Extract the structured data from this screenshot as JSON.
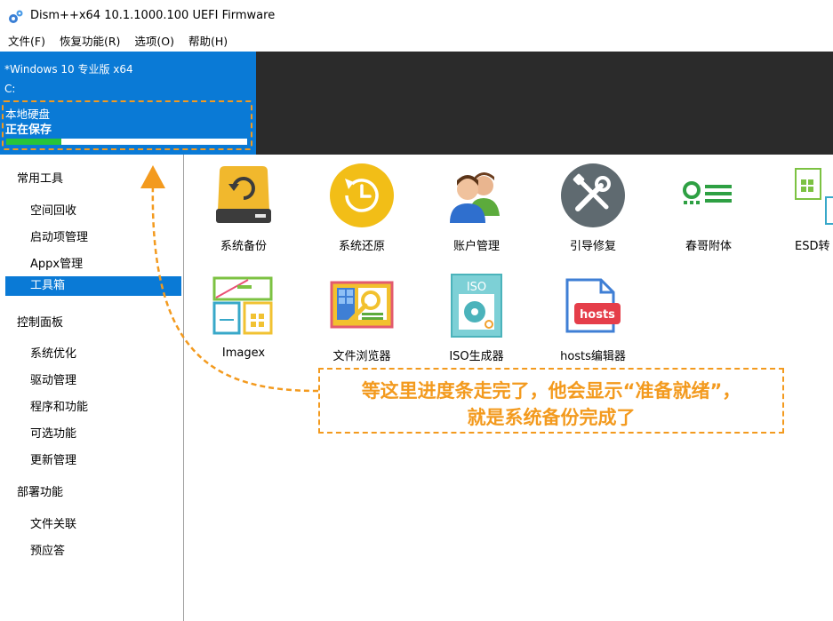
{
  "window": {
    "title": "Dism++x64 10.1.1000.100 UEFI Firmware"
  },
  "menu": [
    "文件(F)",
    "恢复功能(R)",
    "选项(O)",
    "帮助(H)"
  ],
  "session": {
    "os": "*Windows 10 专业版 x64",
    "drive": "C:",
    "disk": "本地硬盘",
    "status": "正在保存",
    "progress_percent": 23
  },
  "sidebar": {
    "sections": [
      {
        "title": "常用工具",
        "items": [
          "空间回收",
          "启动项管理",
          "Appx管理",
          "工具箱"
        ]
      },
      {
        "title": "控制面板",
        "items": [
          "系统优化",
          "驱动管理",
          "程序和功能",
          "可选功能",
          "更新管理"
        ]
      },
      {
        "title": "部署功能",
        "items": [
          "文件关联",
          "预应答"
        ]
      }
    ],
    "selected": "工具箱"
  },
  "tools": [
    {
      "label": "系统备份",
      "icon": "backup-drive-icon"
    },
    {
      "label": "系统还原",
      "icon": "restore-clock-icon"
    },
    {
      "label": "账户管理",
      "icon": "users-icon"
    },
    {
      "label": "引导修复",
      "icon": "wrench-screwdriver-icon"
    },
    {
      "label": "春哥附体",
      "icon": "toggle-list-icon"
    },
    {
      "label": "ESD转",
      "icon": "esd-convert-icon"
    },
    {
      "label": "Imagex",
      "icon": "imagex-icon"
    },
    {
      "label": "文件浏览器",
      "icon": "file-browser-icon"
    },
    {
      "label": "ISO生成器",
      "icon": "iso-disc-icon"
    },
    {
      "label": "hosts编辑器",
      "icon": "hosts-file-icon"
    }
  ],
  "annotation": {
    "line1": "等这里进度条走完了，他会显示“准备就绪”，",
    "line2": "就是系统备份完成了"
  },
  "colors": {
    "accent": "#0a7ad6",
    "annotation": "#f39a1e",
    "progress": "#27c43a",
    "strip": "#2b2b2b"
  }
}
